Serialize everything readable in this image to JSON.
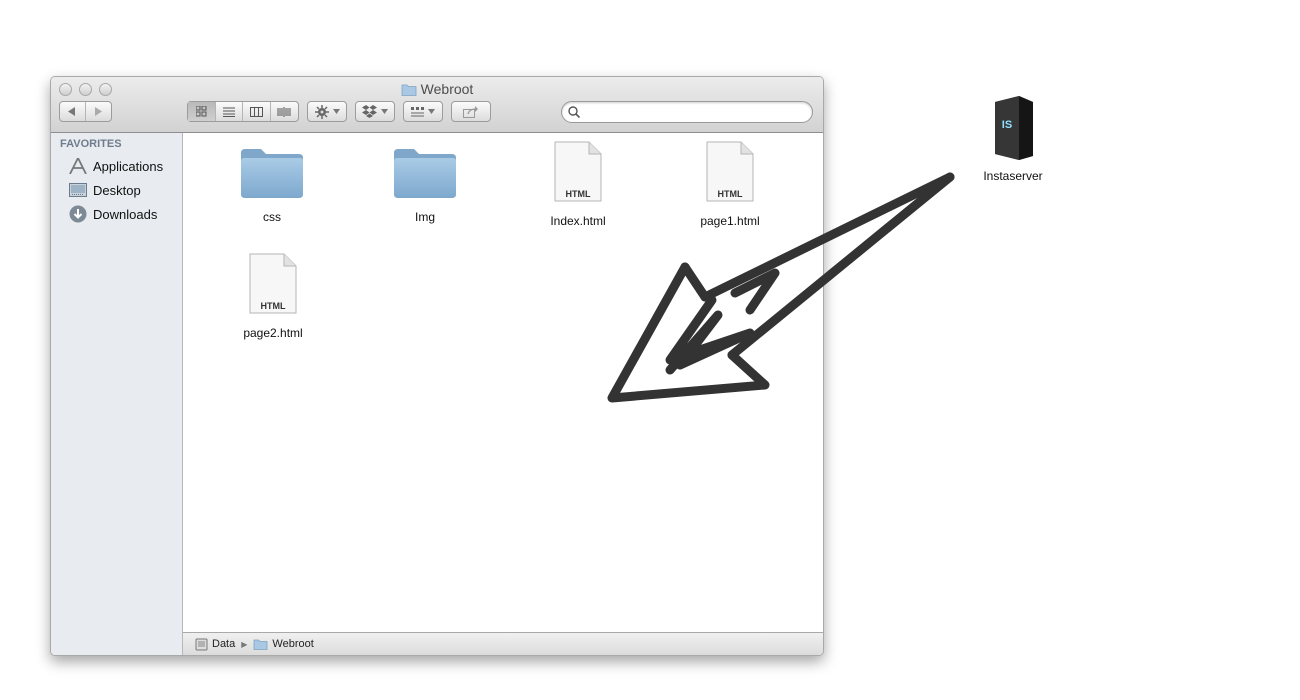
{
  "window": {
    "title": "Webroot",
    "search": {
      "placeholder": "",
      "value": ""
    }
  },
  "toolbar": {
    "back_icon": "back-arrow-icon",
    "forward_icon": "forward-arrow-icon",
    "view_modes": [
      "icon-view",
      "list-view",
      "column-view",
      "cover-flow-view"
    ],
    "active_view": "icon-view",
    "action_icon": "gear-icon",
    "dropbox_icon": "dropbox-icon",
    "arrange_icon": "arrange-icon",
    "share_icon": "share-icon"
  },
  "sidebar": {
    "heading": "FAVORITES",
    "items": [
      {
        "label": "Applications",
        "icon": "applications-icon"
      },
      {
        "label": "Desktop",
        "icon": "desktop-icon"
      },
      {
        "label": "Downloads",
        "icon": "downloads-icon"
      }
    ]
  },
  "files": [
    {
      "name": "css",
      "kind": "folder"
    },
    {
      "name": "Img",
      "kind": "folder"
    },
    {
      "name": "Index.html",
      "kind": "html",
      "badge": "HTML"
    },
    {
      "name": "page1.html",
      "kind": "html",
      "badge": "HTML"
    },
    {
      "name": "page2.html",
      "kind": "html",
      "badge": "HTML"
    }
  ],
  "statusbar": {
    "path": [
      {
        "label": "Data",
        "icon": "drive-icon"
      },
      {
        "label": "Webroot",
        "icon": "folder-icon"
      }
    ]
  },
  "desktop": {
    "icon_label": "Instaserver",
    "icon_badge": "IS",
    "icon": "server-icon"
  },
  "annotation": {
    "icon": "hand-drawn-arrow-icon"
  },
  "colors": {
    "sidebar_bg": "#e8ecf1",
    "folder_blue": "#8fb8d8",
    "arrow": "#333333"
  }
}
